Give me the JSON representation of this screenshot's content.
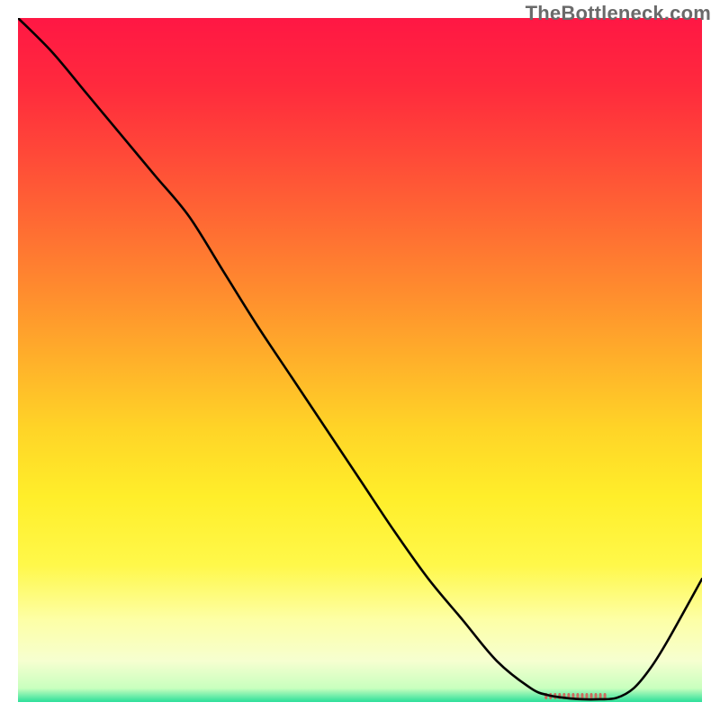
{
  "watermark": "TheBottleneck.com",
  "chart_data": {
    "type": "line",
    "title": "",
    "xlabel": "",
    "ylabel": "",
    "xlim": [
      0,
      100
    ],
    "ylim": [
      0,
      100
    ],
    "grid": false,
    "legend": false,
    "series": [
      {
        "name": "curve",
        "x": [
          0,
          5,
          10,
          15,
          20,
          25,
          30,
          35,
          40,
          45,
          50,
          55,
          60,
          65,
          70,
          75,
          77.5,
          80,
          82.5,
          85,
          87.5,
          90,
          92.5,
          95,
          100
        ],
        "y": [
          100,
          95,
          89,
          83,
          77,
          71,
          63,
          55,
          47.5,
          40,
          32.5,
          25,
          18,
          12,
          6,
          2,
          1,
          0.6,
          0.4,
          0.4,
          0.6,
          2,
          5,
          9,
          18
        ]
      }
    ],
    "gradient_stops": [
      {
        "t": 0.0,
        "color": "#ff1744"
      },
      {
        "t": 0.1,
        "color": "#ff2a3d"
      },
      {
        "t": 0.2,
        "color": "#ff4938"
      },
      {
        "t": 0.3,
        "color": "#ff6a33"
      },
      {
        "t": 0.4,
        "color": "#ff8c2e"
      },
      {
        "t": 0.5,
        "color": "#ffb02a"
      },
      {
        "t": 0.6,
        "color": "#ffd427"
      },
      {
        "t": 0.7,
        "color": "#ffee2a"
      },
      {
        "t": 0.8,
        "color": "#fff84a"
      },
      {
        "t": 0.88,
        "color": "#fdffa6"
      },
      {
        "t": 0.94,
        "color": "#f6ffd0"
      },
      {
        "t": 0.98,
        "color": "#c8ffbe"
      },
      {
        "t": 1.0,
        "color": "#2bdf9a"
      }
    ],
    "optimum_marker": {
      "x_start": 77,
      "x_end": 86,
      "color": "#cc6b5f"
    },
    "line_style": {
      "color": "#000000",
      "width": 2.6
    }
  }
}
